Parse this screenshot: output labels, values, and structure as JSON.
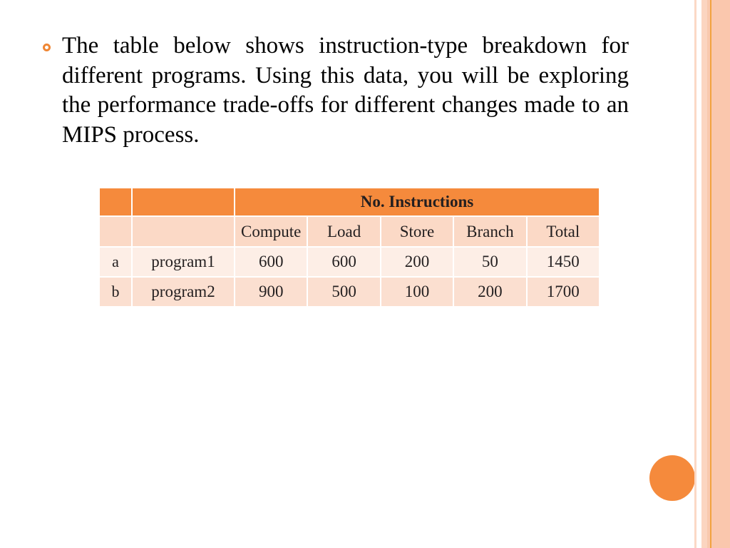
{
  "slide": {
    "background_color": "#ffffff",
    "accent_color": "#f58a3c",
    "bullet_marker_color": "#ef8634"
  },
  "content": {
    "bullet_text": "The table below shows instruction-type breakdown for different programs. Using this data, you will be exploring the performance trade-offs for different changes made to an MIPS process."
  },
  "table": {
    "group_header": "No. Instructions",
    "column_headers": [
      "",
      "",
      "Compute",
      "Load",
      "Store",
      "Branch",
      "Total"
    ],
    "rows": [
      {
        "label": "a",
        "program": "program1",
        "compute": "600",
        "load": "600",
        "store": "200",
        "branch": "50",
        "total": "1450"
      },
      {
        "label": "b",
        "program": "program2",
        "compute": "900",
        "load": "500",
        "store": "100",
        "branch": "200",
        "total": "1700"
      }
    ],
    "colors": {
      "header_orange": "#f58a3c",
      "subheader_pink": "#fbd9c6",
      "row_a": "#fdeee6",
      "row_b": "#fbdfd0",
      "text": "#231f20",
      "header_text": "#ffffff"
    }
  },
  "decoration": {
    "dot_color": "#f58a3c",
    "stripe_colors": [
      "#fbd9c6",
      "#fbd5c0",
      "#f9c9ae",
      "#f0921f",
      "#fac7ad"
    ]
  }
}
